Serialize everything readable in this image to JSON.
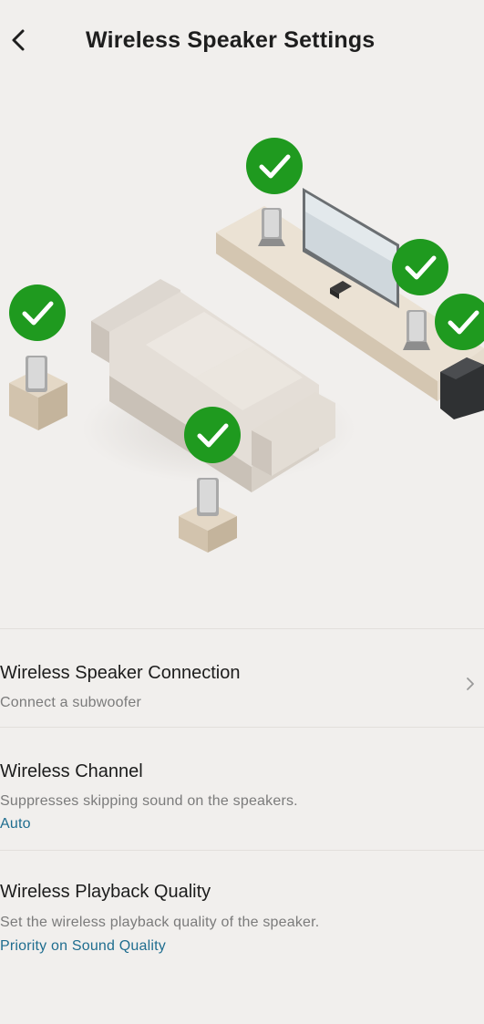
{
  "header": {
    "back_icon": "chevron-left-icon",
    "title": "Wireless Speaker Settings"
  },
  "illustration": {
    "check_icon": "check-circle-icon",
    "check_color": "#1f9a1f",
    "connected_speakers": [
      "rear-left",
      "rear-center",
      "front-left",
      "front-right",
      "side-right"
    ]
  },
  "settings": [
    {
      "title": "Wireless Speaker Connection",
      "description": "Connect a subwoofer",
      "trailing_icon": "chevron-right-icon"
    },
    {
      "title": "Wireless Channel",
      "description": "Suppresses skipping sound on the speakers.",
      "value": "Auto"
    },
    {
      "title": "Wireless Playback Quality",
      "description": "Set the wireless playback quality of the speaker.",
      "value": "Priority on Sound Quality"
    }
  ],
  "colors": {
    "background": "#f1efed",
    "accent_text": "#1f6d8f",
    "secondary_text": "#7b7b7b"
  }
}
